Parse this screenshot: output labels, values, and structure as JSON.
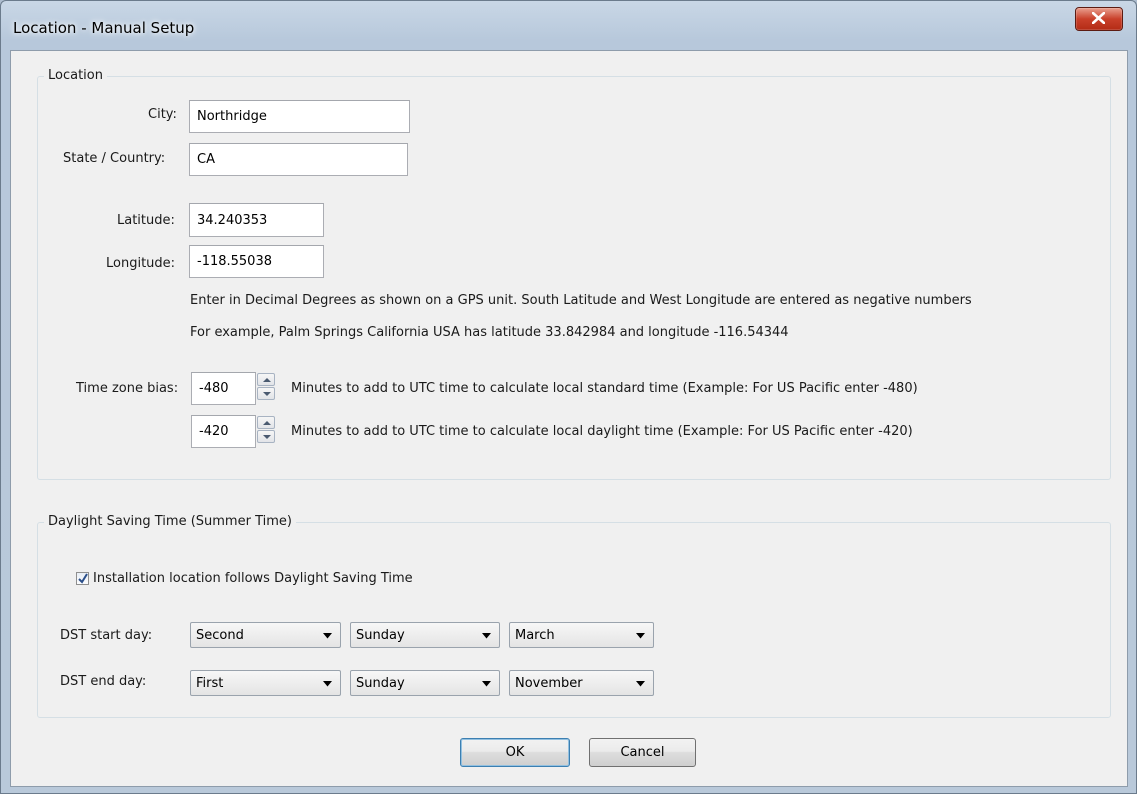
{
  "window": {
    "title": "Location - Manual Setup"
  },
  "location_group": {
    "legend": "Location",
    "city_label": "City:",
    "city_value": "Northridge",
    "state_label": "State / Country:",
    "state_value": "CA",
    "latitude_label": "Latitude:",
    "latitude_value": "34.240353",
    "longitude_label": "Longitude:",
    "longitude_value": "-118.55038",
    "hint_line1": "Enter in Decimal Degrees as shown on a GPS unit.  South Latitude and West Longitude are entered as negative numbers",
    "hint_line2": "For example, Palm Springs California USA has latitude 33.842984 and longitude -116.54344",
    "tz_label": "Time zone bias:",
    "tz_standard_value": "-480",
    "tz_standard_desc": "Minutes to add to UTC time to calculate local standard time (Example: For US Pacific enter -480)",
    "tz_daylight_value": "-420",
    "tz_daylight_desc": "Minutes to add to UTC time to calculate local daylight time (Example: For US Pacific enter -420)"
  },
  "dst_group": {
    "legend": "Daylight Saving Time (Summer Time)",
    "follows_dst_label": "Installation location follows Daylight Saving Time",
    "follows_dst_checked": true,
    "start_label": "DST start day:",
    "start_week": "Second",
    "start_weekday": "Sunday",
    "start_month": "March",
    "end_label": "DST end day:",
    "end_week": "First",
    "end_weekday": "Sunday",
    "end_month": "November"
  },
  "buttons": {
    "ok": "OK",
    "cancel": "Cancel"
  },
  "colors": {
    "close_button": "#c9402a",
    "default_button_border": "#3c7fb1",
    "dialog_bg": "#f0f0f0"
  }
}
